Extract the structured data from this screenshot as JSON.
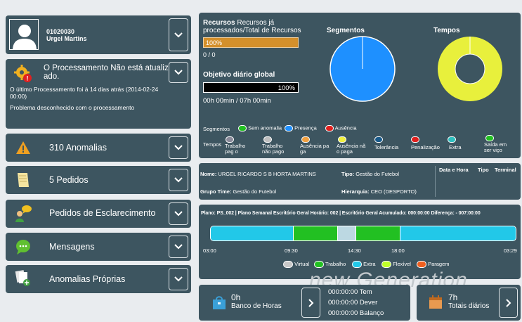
{
  "user": {
    "id": "01020030",
    "name": "Urgel Martins"
  },
  "processing": {
    "title": "O Processamento Não está atualiz ado.",
    "last": "O último Processamento foi à 14 dias atrás (2014-02-24 00:00)",
    "problem": "Problema desconhecido com o processamento"
  },
  "rows": {
    "anomalias": "310 Anomalias",
    "pedidos": "5 Pedidos",
    "esclarecimento": "Pedidos de Esclarecimento",
    "mensagens": "Mensagens",
    "proprias": "Anomalias Próprias"
  },
  "stats": {
    "recursos_bold": "Recursos",
    "recursos_text": "Recursos já processados/Total de Recursos",
    "recursos_pct": "100%",
    "recursos_count": "0 / 0",
    "objetivo_title": "Objetivo diário global",
    "objetivo_pct": "100%",
    "objetivo_time": "00h 00min / 07h 00min",
    "segmentos_title": "Segmentos",
    "tempos_title": "Tempos",
    "colors": {
      "presenca": "#1e90ff",
      "tempo_ring": "#e8f03c",
      "progress": "#d4902b"
    }
  },
  "legend": {
    "segmentos_label": "Segmentos",
    "segmentos": [
      {
        "label": "Sem anomalia",
        "color": "#22c022"
      },
      {
        "label": "Presença",
        "color": "#1e90ff"
      },
      {
        "label": "Ausência",
        "color": "#e0201e"
      }
    ],
    "tempos_label": "Tempos",
    "tempos": [
      {
        "label": "Trabalho pag o",
        "color": "#8a8a9a"
      },
      {
        "label": "Trabalho não pago",
        "color": "#c0c0c0"
      },
      {
        "label": "Ausência pa ga",
        "color": "#f0a040"
      },
      {
        "label": "Ausência nã o paga",
        "color": "#f0f040"
      },
      {
        "label": "Tolerância",
        "color": "#1a5a8a"
      },
      {
        "label": "Penalização",
        "color": "#e0201e"
      },
      {
        "label": "Extra",
        "color": "#30c0c0"
      },
      {
        "label": "Saída em ser viço",
        "color": "#22c022"
      }
    ]
  },
  "employee": {
    "nome_label": "Nome:",
    "nome": "URGEL RICARDO S B HORTA MARTINS",
    "tipo_label": "Tipo:",
    "tipo": "Gestão do Futebol",
    "grupo_label": "Grupo Time:",
    "grupo": "Gestão do Futebol",
    "hier_label": "Hierarquia:",
    "hier": "CEO (DESPORTO)",
    "cols": [
      "Data e Hora",
      "Tipo",
      "Terminal"
    ]
  },
  "plan": {
    "info": "Plano: PS_002 | Plano Semanal Escritório Geral  Horário: 002 | Escritório Geral  Acumulado: 000:00:00  Diferença: - 007:00:00",
    "ticks": [
      "03:00",
      "09:30",
      "14:30",
      "18:00",
      "03:29"
    ],
    "legend": [
      {
        "label": "Virtual",
        "color": "#c8c8c8"
      },
      {
        "label": "Trabalho",
        "color": "#22c022"
      },
      {
        "label": "Extra",
        "color": "#22c8e8"
      },
      {
        "label": "Flexível",
        "color": "#bfff2a"
      },
      {
        "label": "Paragem",
        "color": "#f06020"
      }
    ]
  },
  "bank": {
    "value": "0h",
    "label": "Banco de Horas",
    "tem": "000:00:00 Tem",
    "dever": "000:00:00 Dever",
    "balanco": "000:00:00 Balanço"
  },
  "totals": {
    "value": "7h",
    "label": "Totais diários"
  },
  "watermark": "new Generation"
}
